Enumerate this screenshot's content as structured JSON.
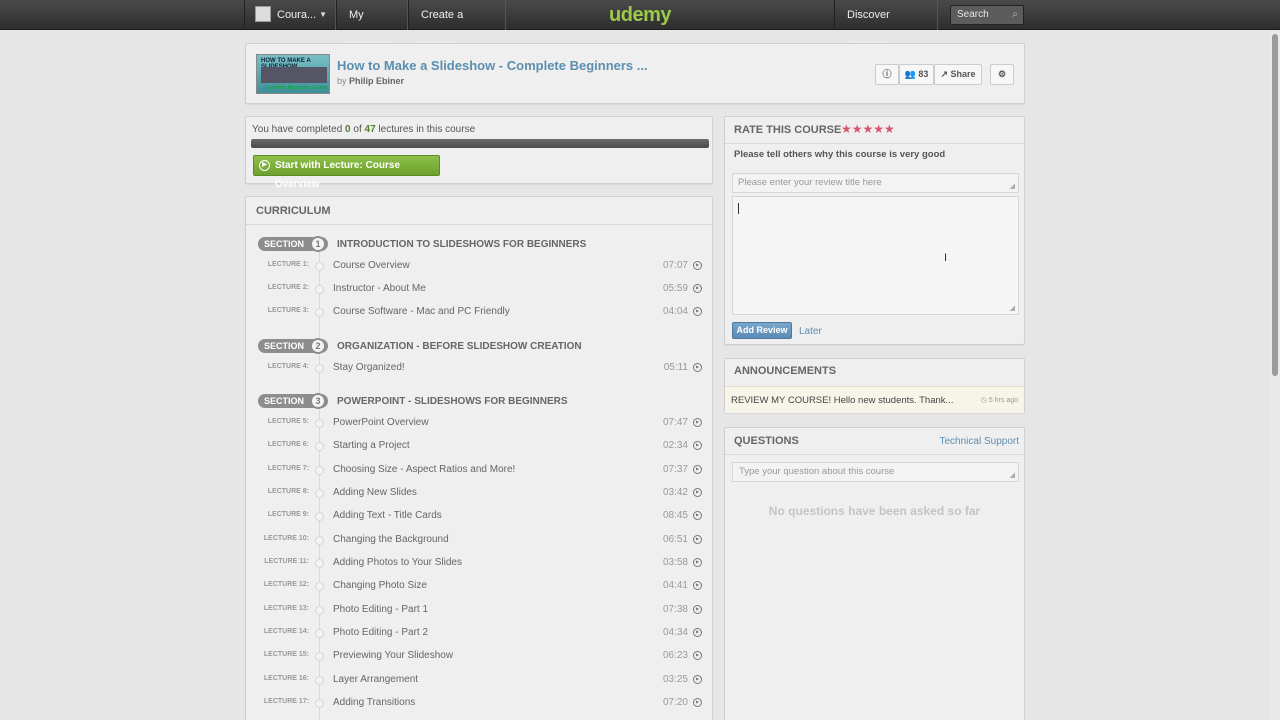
{
  "topbar": {
    "course_label": "Coura...",
    "my_courses": "My Courses",
    "create_course": "Create a Course",
    "logo": "udemy",
    "discover": "Discover Courses",
    "search_placeholder": "Search"
  },
  "course": {
    "title": "How to Make a Slideshow - Complete Beginners ...",
    "by": "by",
    "author": "Philip Ebiner",
    "thumb_title": "HOW TO MAKE A SLIDESHOW",
    "thumb_subtitle": "Complete Beginners Course",
    "students": "83",
    "share": "Share"
  },
  "progress": {
    "prefix": "You have completed",
    "completed": "0",
    "of": "of",
    "total": "47",
    "suffix": "lectures in this course",
    "fraction": 0.0,
    "start_button": "Start with Lecture: Course Overview"
  },
  "curriculum": {
    "title": "CURRICULUM",
    "section_label": "SECTION",
    "sections": [
      {
        "num": "1",
        "title": "INTRODUCTION TO SLIDESHOWS FOR BEGINNERS"
      },
      {
        "num": "2",
        "title": "ORGANIZATION - BEFORE SLIDESHOW CREATION"
      },
      {
        "num": "3",
        "title": "POWERPOINT - SLIDESHOWS FOR BEGINNERS"
      }
    ],
    "lectures": [
      {
        "label": "LECTURE 1:",
        "title": "Course Overview",
        "time": "07:07"
      },
      {
        "label": "LECTURE 2:",
        "title": "Instructor - About Me",
        "time": "05:59"
      },
      {
        "label": "LECTURE 3:",
        "title": "Course Software - Mac and PC Friendly",
        "time": "04:04"
      },
      {
        "label": "LECTURE 4:",
        "title": "Stay Organized!",
        "time": "05:11"
      },
      {
        "label": "LECTURE 5:",
        "title": "PowerPoint Overview",
        "time": "07:47"
      },
      {
        "label": "LECTURE 6:",
        "title": "Starting a Project",
        "time": "02:34"
      },
      {
        "label": "LECTURE 7:",
        "title": "Choosing Size - Aspect Ratios and More!",
        "time": "07:37"
      },
      {
        "label": "LECTURE 8:",
        "title": "Adding New Slides",
        "time": "03:42"
      },
      {
        "label": "LECTURE 9:",
        "title": "Adding Text - Title Cards",
        "time": "08:45"
      },
      {
        "label": "LECTURE 10:",
        "title": "Changing the Background",
        "time": "06:51"
      },
      {
        "label": "LECTURE 11:",
        "title": "Adding Photos to Your Slides",
        "time": "03:58"
      },
      {
        "label": "LECTURE 12:",
        "title": "Changing Photo Size",
        "time": "04:41"
      },
      {
        "label": "LECTURE 13:",
        "title": "Photo Editing - Part 1",
        "time": "07:38"
      },
      {
        "label": "LECTURE 14:",
        "title": "Photo Editing - Part 2",
        "time": "04:34"
      },
      {
        "label": "LECTURE 15:",
        "title": "Previewing Your Slideshow",
        "time": "06:23"
      },
      {
        "label": "LECTURE 16:",
        "title": "Layer Arrangement",
        "time": "03:25"
      },
      {
        "label": "LECTURE 17:",
        "title": "Adding Transitions",
        "time": "07:20"
      }
    ]
  },
  "rate": {
    "title": "RATE THIS COURSE",
    "stars": "★★★★★",
    "subtitle": "Please tell others why this course is very good",
    "title_placeholder": "Please enter your review title here",
    "add_button": "Add Review",
    "later": "Later"
  },
  "announcements": {
    "title": "ANNOUNCEMENTS",
    "text": "REVIEW MY COURSE! Hello new students. Thank...",
    "time": "5 hrs ago"
  },
  "questions": {
    "title": "QUESTIONS",
    "support_link": "Technical Support",
    "placeholder": "Type your question about this course",
    "empty": "No questions have been asked so far"
  },
  "colors": {
    "accent_green": "#8bbd3a",
    "link_blue": "#5b8fb0",
    "star_pink": "#d9536b"
  }
}
